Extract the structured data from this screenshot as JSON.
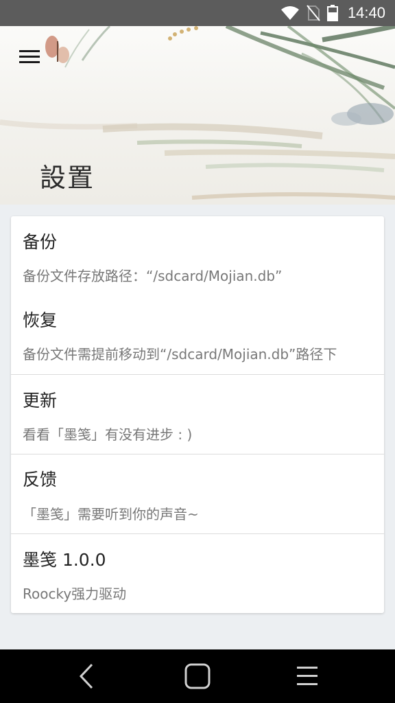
{
  "status_bar": {
    "time": "14:40",
    "icons": [
      "wifi-icon",
      "no-sim-icon",
      "battery-icon"
    ]
  },
  "header": {
    "title": "設置",
    "menu_icon": "hamburger-menu-icon"
  },
  "settings": {
    "items": [
      {
        "title": "备份",
        "subtitle": "备份文件存放路径：“/sdcard/Mojian.db”"
      },
      {
        "title": "恢复",
        "subtitle": "备份文件需提前移动到“/sdcard/Mojian.db”路径下"
      },
      {
        "title": "更新",
        "subtitle": "看看「墨笺」有没有进步 : )"
      },
      {
        "title": "反馈",
        "subtitle": "「墨笺」需要听到你的声音~"
      },
      {
        "title": "墨笺 1.0.0",
        "subtitle": "Roocky强力驱动"
      }
    ]
  },
  "nav_bar": {
    "icons": [
      "back-icon",
      "home-icon",
      "recents-menu-icon"
    ]
  },
  "colors": {
    "status_bar": "#5c5c5c",
    "background": "#eceff2",
    "card": "#ffffff",
    "title_text": "#222222",
    "subtitle_text": "#777777"
  }
}
